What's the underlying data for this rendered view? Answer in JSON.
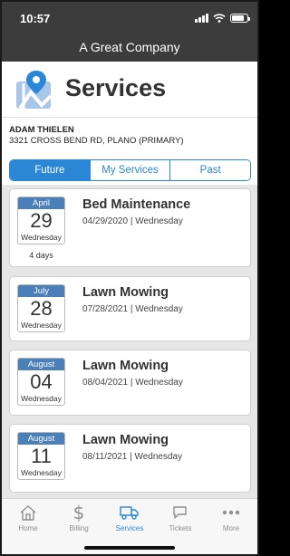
{
  "status_bar": {
    "time": "10:57"
  },
  "app_header": {
    "title": "A Great Company"
  },
  "page": {
    "title": "Services",
    "logo_icon": "map-pin-icon"
  },
  "customer": {
    "name": "ADAM THIELEN",
    "address": "3321 CROSS BEND RD, PLANO (PRIMARY)"
  },
  "tabs": [
    {
      "label": "Future",
      "active": true
    },
    {
      "label": "My Services",
      "active": false
    },
    {
      "label": "Past",
      "active": false
    }
  ],
  "services": [
    {
      "month": "April",
      "day": "29",
      "weekday": "Wednesday",
      "days_away": "4 days",
      "name": "Bed Maintenance",
      "date_line": "04/29/2020 | Wednesday"
    },
    {
      "month": "July",
      "day": "28",
      "weekday": "Wednesday",
      "name": "Lawn Mowing",
      "date_line": "07/28/2021 | Wednesday"
    },
    {
      "month": "August",
      "day": "04",
      "weekday": "Wednesday",
      "name": "Lawn Mowing",
      "date_line": "08/04/2021 | Wednesday"
    },
    {
      "month": "August",
      "day": "11",
      "weekday": "Wednesday",
      "name": "Lawn Mowing",
      "date_line": "08/11/2021 | Wednesday"
    }
  ],
  "tab_bar": [
    {
      "label": "Home",
      "icon": "home-icon",
      "active": false
    },
    {
      "label": "Billing",
      "icon": "dollar-icon",
      "active": false
    },
    {
      "label": "Services",
      "icon": "truck-icon",
      "active": true
    },
    {
      "label": "Tickets",
      "icon": "chat-icon",
      "active": false
    },
    {
      "label": "More",
      "icon": "more-icon",
      "active": false
    }
  ],
  "colors": {
    "header": "#3c3c3c",
    "accent": "#2b86d6",
    "date_header": "#4a7fb8",
    "list_bg": "#e6e6e6"
  }
}
